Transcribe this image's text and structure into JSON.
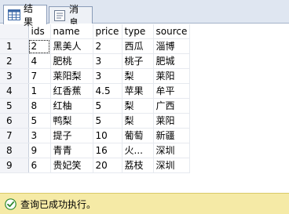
{
  "tabs": [
    {
      "label": "结果",
      "icon": "grid-icon",
      "active": true
    },
    {
      "label": "消息",
      "icon": "messages-icon",
      "active": false
    }
  ],
  "grid": {
    "columns": [
      "ids",
      "name",
      "price",
      "type",
      "source"
    ],
    "rows": [
      {
        "num": "1",
        "ids": "2",
        "name": "黑美人",
        "price": "2",
        "type": "西瓜",
        "source": "淄博"
      },
      {
        "num": "2",
        "ids": "4",
        "name": "肥桃",
        "price": "3",
        "type": "桃子",
        "source": "肥城"
      },
      {
        "num": "3",
        "ids": "7",
        "name": "莱阳梨",
        "price": "3",
        "type": "梨",
        "source": "莱阳"
      },
      {
        "num": "4",
        "ids": "1",
        "name": "红香蕉",
        "price": "4.5",
        "type": "苹果",
        "source": "牟平"
      },
      {
        "num": "5",
        "ids": "8",
        "name": "红柚",
        "price": "5",
        "type": "梨",
        "source": "广西"
      },
      {
        "num": "6",
        "ids": "5",
        "name": "鸭梨",
        "price": "5",
        "type": "梨",
        "source": "莱阳"
      },
      {
        "num": "7",
        "ids": "3",
        "name": "提子",
        "price": "10",
        "type": "葡萄",
        "source": "新疆"
      },
      {
        "num": "8",
        "ids": "9",
        "name": "青青",
        "price": "16",
        "type": "火...",
        "source": "深圳"
      },
      {
        "num": "9",
        "ids": "6",
        "name": "贵妃笑",
        "price": "20",
        "type": "荔枝",
        "source": "深圳"
      }
    ]
  },
  "status": {
    "icon": "success-check-icon",
    "text": "查询已成功执行。",
    "color": "#f5eaa6"
  }
}
